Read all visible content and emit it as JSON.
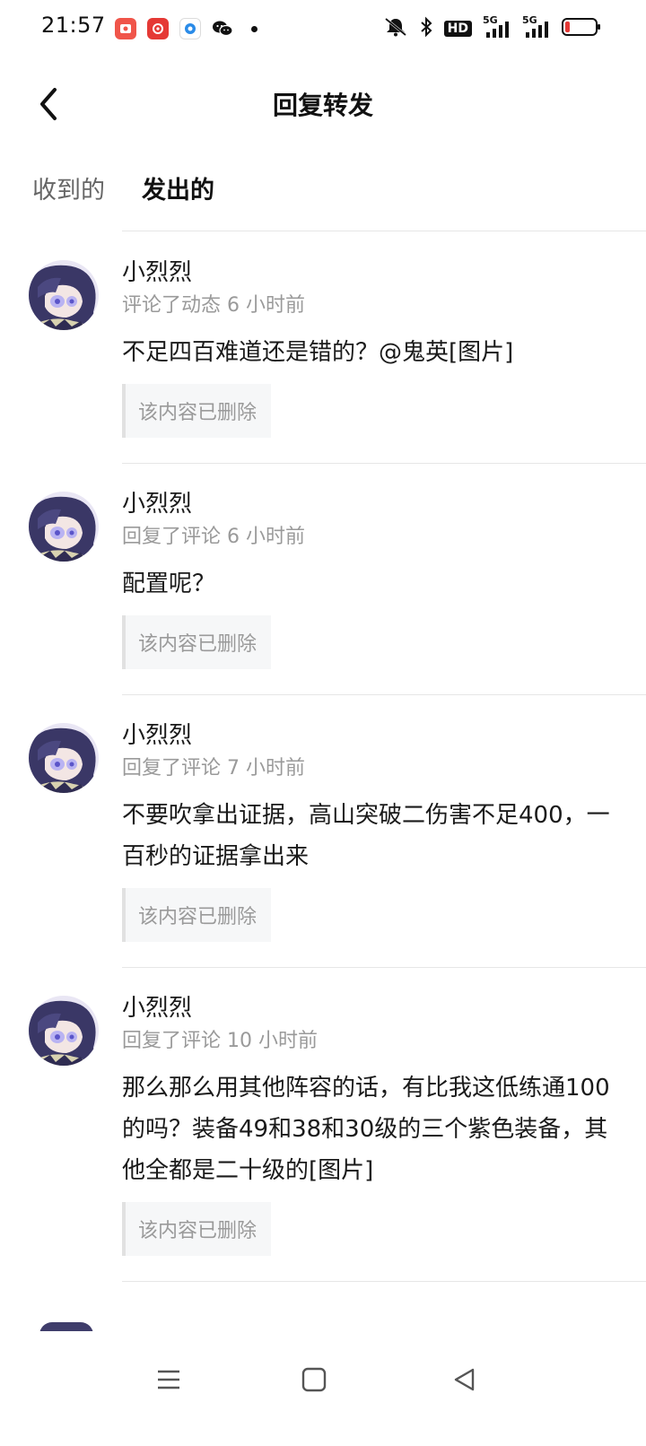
{
  "status_bar": {
    "time": "21:57",
    "apps": [
      "photo-app-icon",
      "music-app-icon",
      "browser-app-icon",
      "wechat-icon"
    ],
    "indicators": [
      "mute-icon",
      "bluetooth-icon",
      "hd-icon",
      "signal-5g-icon",
      "signal-5g-icon",
      "battery-low-icon"
    ],
    "hd_label": "HD",
    "network_label_1": "5G",
    "network_label_2": "5G"
  },
  "header": {
    "title": "回复转发",
    "back_icon": "chevron-left-icon"
  },
  "tabs": [
    {
      "label": "收到的",
      "selected": false
    },
    {
      "label": "发出的",
      "selected": true
    }
  ],
  "accent_color": "#27c2b0",
  "items": [
    {
      "username": "小烈烈",
      "meta": "评论了动态 6 小时前",
      "content": "不足四百难道还是错的？@鬼英[图片]",
      "quote": "该内容已删除"
    },
    {
      "username": "小烈烈",
      "meta": "回复了评论 6 小时前",
      "content": "配置呢？",
      "quote": "该内容已删除"
    },
    {
      "username": "小烈烈",
      "meta": "回复了评论 7 小时前",
      "content": "不要吹拿出证据，高山突破二伤害不足400，一百秒的证据拿出来",
      "quote": "该内容已删除"
    },
    {
      "username": "小烈烈",
      "meta": "回复了评论 10 小时前",
      "content": "那么那么用其他阵容的话，有比我这低练通100的吗？装备49和38和30级的三个紫色装备，其他全都是二十级的[图片]",
      "quote": "该内容已删除"
    }
  ],
  "nav": {
    "menu_icon": "menu-icon",
    "home_icon": "home-square-icon",
    "back_icon": "back-triangle-icon"
  }
}
